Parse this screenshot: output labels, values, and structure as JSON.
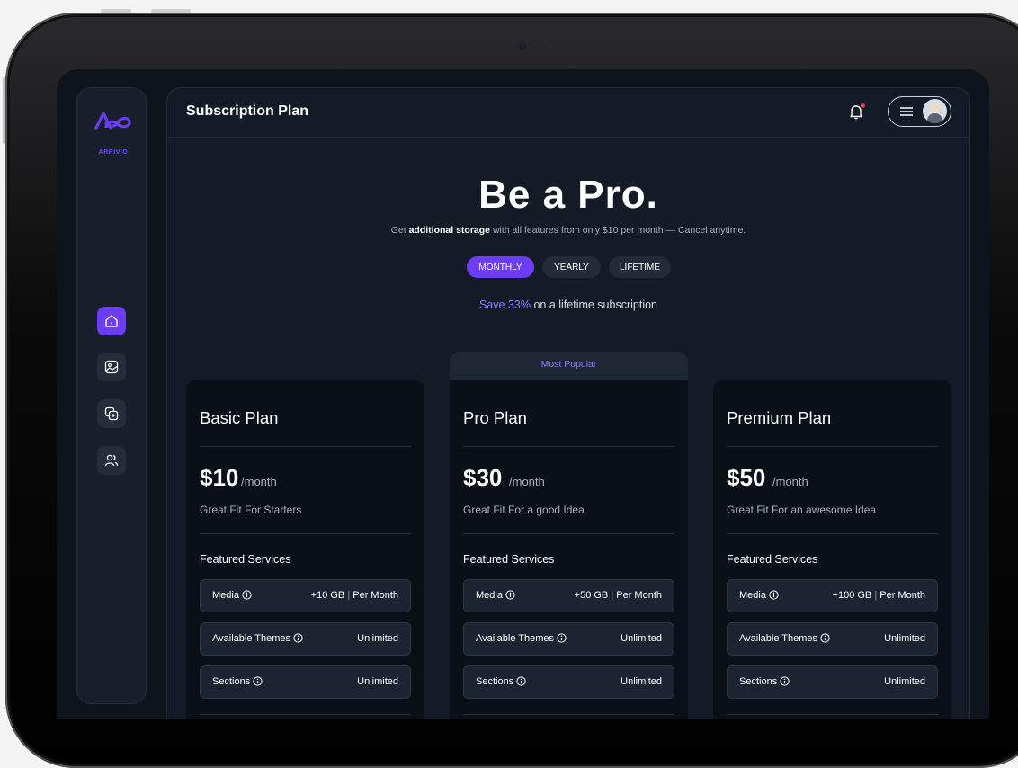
{
  "app": {
    "brand": "ARRIVIO",
    "accent": "#6d3cf5",
    "accent_text": "#8f7bff"
  },
  "header": {
    "title": "Subscription Plan",
    "bell_icon": "bell-icon",
    "menu_icon": "hamburger-icon",
    "notification_dot_color": "#e0433e"
  },
  "sidebar": {
    "items": [
      {
        "name": "home",
        "icon": "home-icon",
        "active": true
      },
      {
        "name": "gallery",
        "icon": "image-icon",
        "active": false
      },
      {
        "name": "copy",
        "icon": "copy-icon",
        "active": false
      },
      {
        "name": "users",
        "icon": "users-icon",
        "active": false
      }
    ]
  },
  "hero": {
    "title": "Be a Pro.",
    "subtitle_pre": "Get ",
    "subtitle_bold": "additional storage",
    "subtitle_post": " with all features from only $10 per month — Cancel anytime.",
    "billing_options": [
      "MONTHLY",
      "YEARLY",
      "LIFETIME"
    ],
    "selected_billing": "MONTHLY",
    "save_accent": "Save 33%",
    "save_rest": " on a lifetime subscription"
  },
  "popular_label": "Most Popular",
  "plans": [
    {
      "name": "Basic Plan",
      "price": "$10",
      "period": "/month",
      "tagline": "Great Fit For Starters",
      "features_heading": "Featured Services",
      "features": [
        {
          "label": "Media",
          "value_main": "+10 GB",
          "value_sep": " | ",
          "value_rest": "Per Month"
        },
        {
          "label": "Available Themes",
          "value_main": "Unlimited"
        },
        {
          "label": "Sections",
          "value_main": "Unlimited"
        }
      ]
    },
    {
      "name": "Pro Plan",
      "price": "$30",
      "period": "/month",
      "tagline": "Great Fit For a good Idea",
      "features_heading": "Featured Services",
      "features": [
        {
          "label": "Media",
          "value_main": "+50 GB",
          "value_sep": " | ",
          "value_rest": "Per Month"
        },
        {
          "label": "Available Themes",
          "value_main": "Unlimited"
        },
        {
          "label": "Sections",
          "value_main": "Unlimited"
        }
      ]
    },
    {
      "name": "Premium Plan",
      "price": "$50",
      "period": "/month",
      "tagline": "Great Fit For an awesome Idea",
      "features_heading": "Featured Services",
      "features": [
        {
          "label": "Media",
          "value_main": "+100 GB",
          "value_sep": " | ",
          "value_rest": "Per Month"
        },
        {
          "label": "Available Themes",
          "value_main": "Unlimited"
        },
        {
          "label": "Sections",
          "value_main": "Unlimited"
        }
      ]
    }
  ]
}
